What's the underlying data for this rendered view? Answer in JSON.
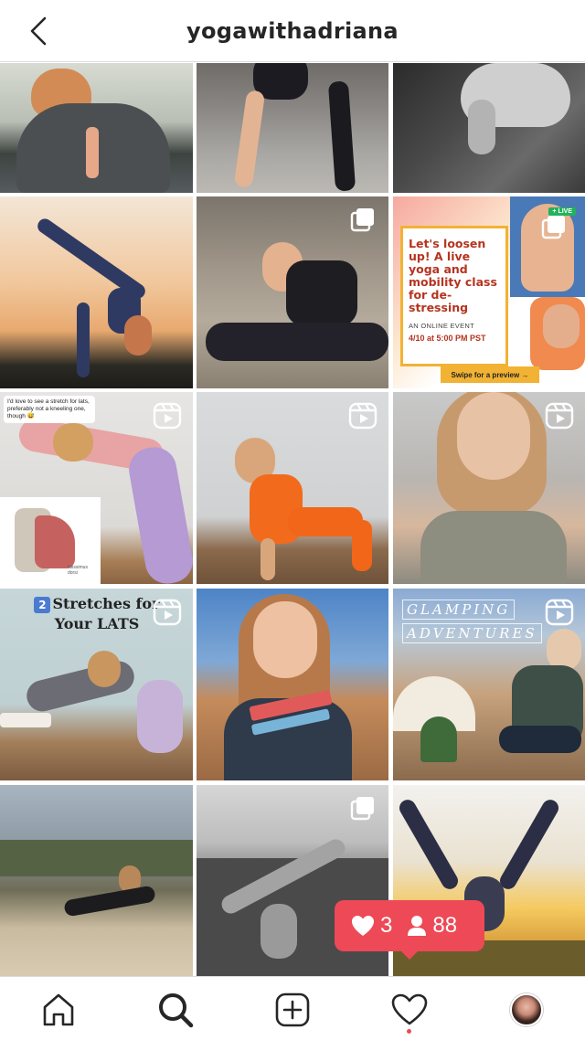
{
  "header": {
    "username": "yogawithadriana",
    "back_icon": "chevron-left-icon"
  },
  "grid": {
    "tiles": [
      {
        "type": "photo",
        "badge": null
      },
      {
        "type": "photo",
        "badge": null
      },
      {
        "type": "photo",
        "badge": null
      },
      {
        "type": "photo",
        "badge": null
      },
      {
        "type": "carousel",
        "badge": "carousel-icon"
      },
      {
        "type": "carousel",
        "badge": "carousel-icon",
        "overlay": {
          "headline": "Let's loosen up! A live yoga and mobility class for de-stressing",
          "subline": "AN ONLINE EVENT",
          "date": "4/10 at 5:00 PM PST",
          "swipe": "Swipe for a preview →",
          "live_tag": "+ LIVE"
        }
      },
      {
        "type": "reel",
        "badge": "reel-icon",
        "overlay": {
          "comment": "I'd love to see a stretch for lats, preferably not a kneeling one, though 😅",
          "anatomy_label": "latissimus dorsi"
        }
      },
      {
        "type": "reel",
        "badge": "reel-icon"
      },
      {
        "type": "reel",
        "badge": "reel-icon"
      },
      {
        "type": "reel",
        "badge": "reel-icon",
        "overlay": {
          "number": "2",
          "line1": "Stretches for",
          "line2": "Your LATS"
        }
      },
      {
        "type": "photo",
        "badge": null
      },
      {
        "type": "reel",
        "badge": "reel-icon",
        "overlay": {
          "line1": "GLAMPING",
          "line2": "ADVENTURES"
        }
      },
      {
        "type": "photo",
        "badge": null
      },
      {
        "type": "carousel",
        "badge": "carousel-icon"
      },
      {
        "type": "photo",
        "badge": null
      }
    ]
  },
  "activity_popup": {
    "likes": "3",
    "follows": "88",
    "color": "#ed4956"
  },
  "bottom_nav": {
    "items": [
      "home-icon",
      "search-icon",
      "new-post-icon",
      "activity-heart-icon",
      "profile-avatar"
    ]
  },
  "colors": {
    "accent": "#ed4956",
    "border": "#dbdbdb",
    "text": "#262626"
  }
}
